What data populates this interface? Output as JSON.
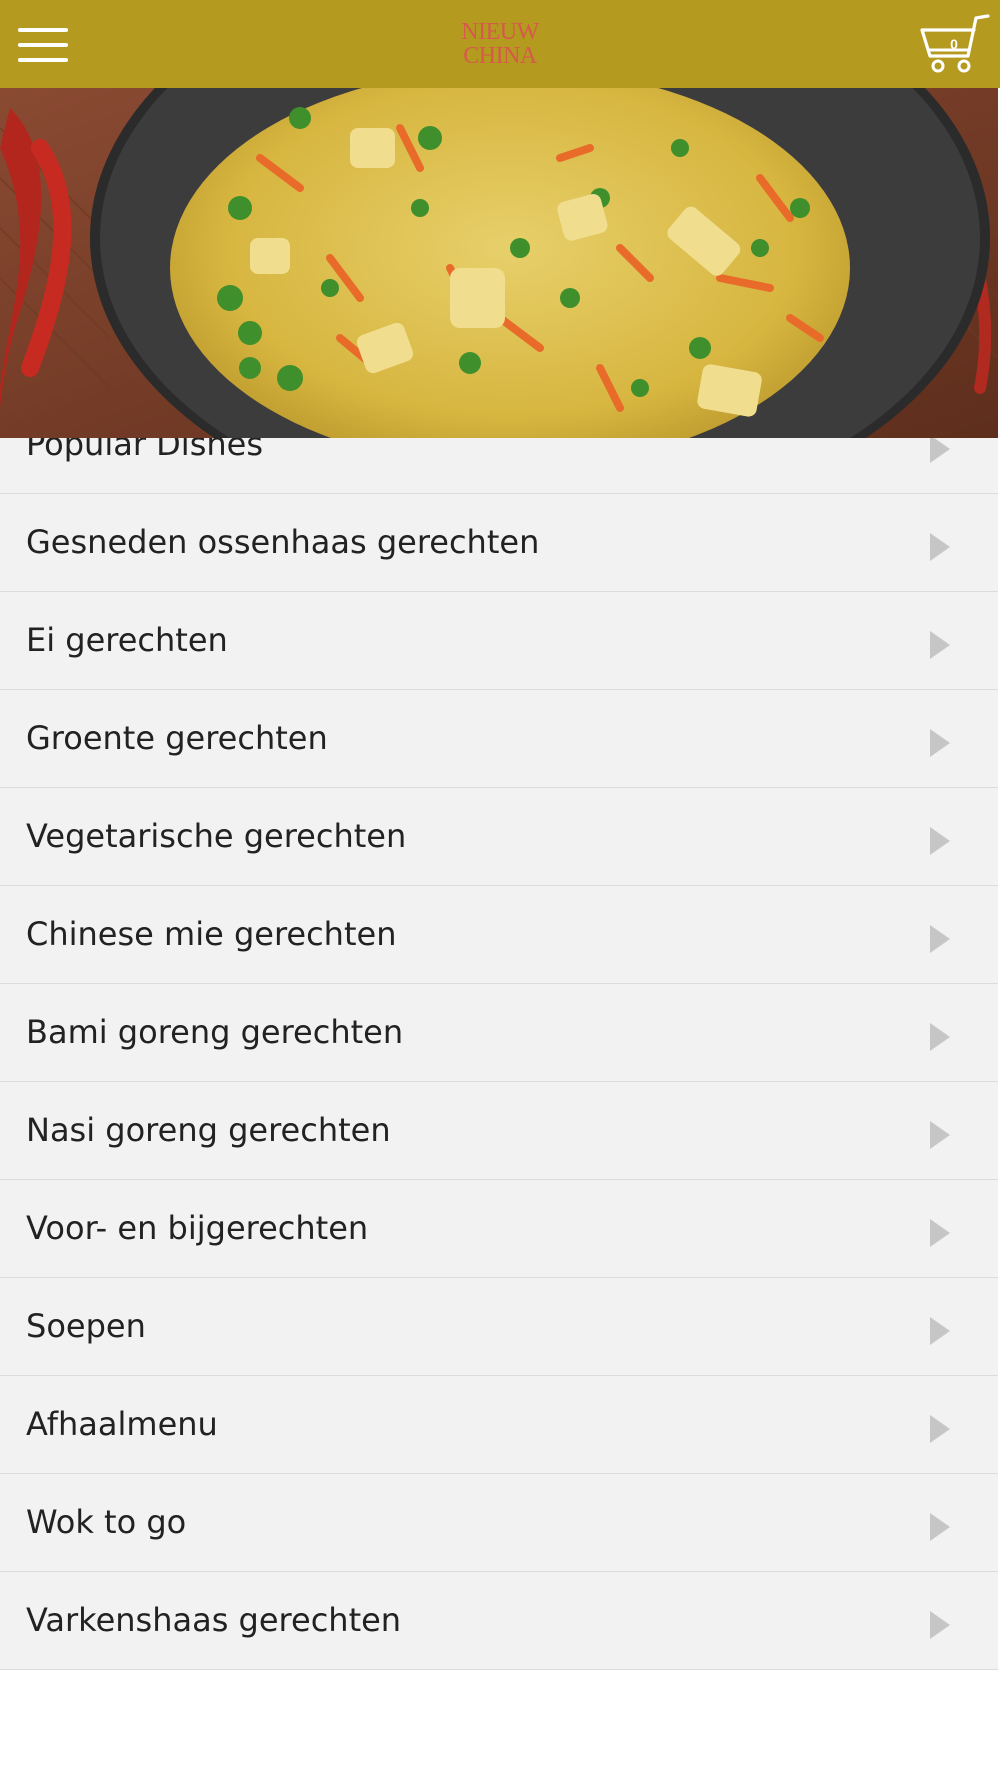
{
  "header": {
    "logo_line1": "NIEUW",
    "logo_line2": "CHINA",
    "cart_count": "0",
    "menu_icon": "hamburger-icon",
    "cart_icon": "shopping-cart-icon",
    "bar_color": "#b49a1f",
    "logo_color": "#d65a4a"
  },
  "hero": {
    "image": "fried-rice-wok-photo"
  },
  "menu": {
    "categories": [
      "Popular Dishes",
      "Gesneden ossenhaas gerechten",
      "Ei gerechten",
      "Groente gerechten",
      "Vegetarische gerechten",
      "Chinese mie gerechten",
      "Bami goreng gerechten",
      "Nasi goreng gerechten",
      "Voor- en bijgerechten",
      "Soepen",
      "Afhaalmenu",
      "Wok to go",
      "Varkenshaas gerechten"
    ]
  }
}
